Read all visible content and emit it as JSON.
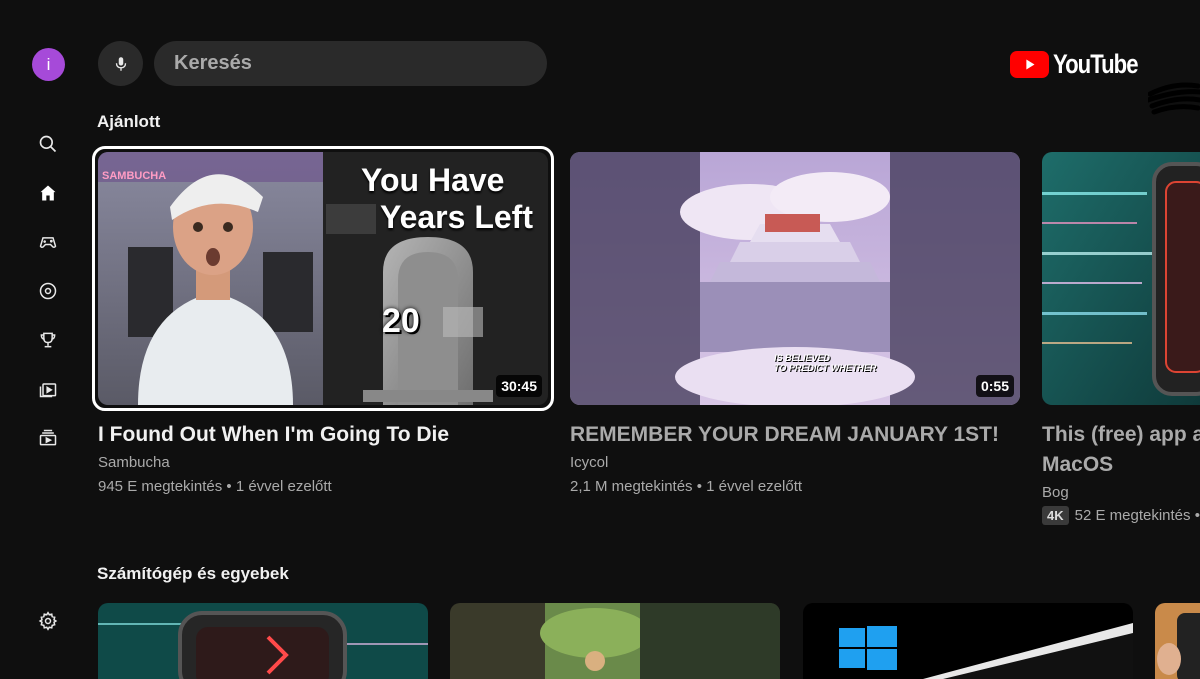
{
  "user": {
    "initial": "i"
  },
  "sidebar": {
    "items": [
      {
        "name": "search",
        "icon": "search-icon"
      },
      {
        "name": "home",
        "icon": "home-icon"
      },
      {
        "name": "gaming",
        "icon": "gamepad-icon"
      },
      {
        "name": "music",
        "icon": "music-disc-icon"
      },
      {
        "name": "trophy",
        "icon": "trophy-icon"
      },
      {
        "name": "subscriptions",
        "icon": "playlist-icon"
      },
      {
        "name": "library",
        "icon": "library-icon"
      }
    ],
    "settings_icon": "gear-icon"
  },
  "search": {
    "placeholder": "Keresés"
  },
  "logo": {
    "text": "YouTube"
  },
  "sections": [
    {
      "title": "Ajánlott",
      "videos": [
        {
          "title": "I Found Out When I'm Going To Die",
          "channel": "Sambucha",
          "meta": "945 E megtekintés • 1 évvel ezelőtt",
          "duration": "30:45",
          "thumb_text_line1": "You Have",
          "thumb_text_line2": "Years Left",
          "thumb_year": "20",
          "thumb_sign": "SAMBUCHA"
        },
        {
          "title": "REMEMBER YOUR DREAM JANUARY 1ST!",
          "channel": "Icycol",
          "meta": "2,1 M megtekintés • 1 évvel ezelőtt",
          "duration": "0:55",
          "thumb_caption_line1": "IS BELIEVED",
          "thumb_caption_line2": "TO PREDICT WHETHER"
        },
        {
          "title_line1": "This (free) app a",
          "title_line2": "MacOS",
          "channel": "Bog",
          "badge": "4K",
          "meta": "52 E megtekintés •"
        }
      ]
    },
    {
      "title": "Számítógép és egyebek"
    }
  ],
  "colors": {
    "accent": "#ff0000",
    "avatar": "#a64ad9",
    "background": "#0f0f0f"
  }
}
